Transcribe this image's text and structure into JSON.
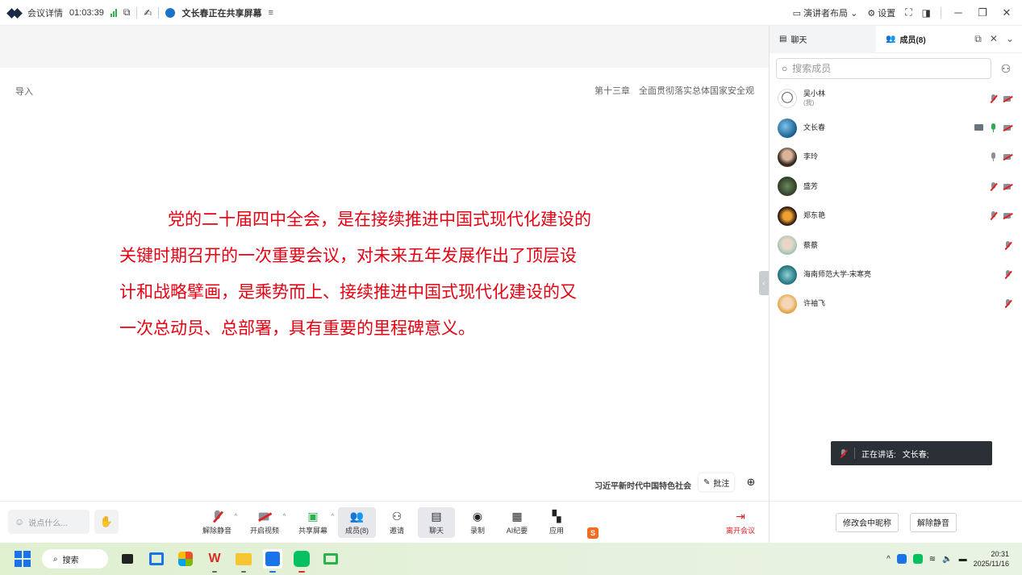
{
  "topbar": {
    "meeting_details": "会议详情",
    "timer": "01:03:39",
    "sharing_text": "文长春正在共享屏幕",
    "layout_label": "演讲者布局",
    "settings_label": "设置"
  },
  "slide": {
    "left_label": "导入",
    "chapter": "第十三章　全面贯彻落实总体国家安全观",
    "lines": [
      "党的二十届四中全会，是在接续推进中国式现代化建设的",
      "关键时期召开的一次重要会议，对未来五年发展作出了顶层设",
      "计和战略擘画，是乘势而上、接续推进中国式现代化建设的又",
      "一次总动员、总部署，具有重要的里程碑意义。"
    ],
    "footer": "习近平新时代中国特色社会",
    "annotate_label": "批注"
  },
  "panel": {
    "tab_chat": "聊天",
    "tab_members": "成员(8)",
    "search_placeholder": "搜索成员",
    "members": [
      {
        "name": "吴小林",
        "sub": "(我)"
      },
      {
        "name": "文长春",
        "sub": ""
      },
      {
        "name": "李玲",
        "sub": ""
      },
      {
        "name": "盛芳",
        "sub": ""
      },
      {
        "name": "郑东艳",
        "sub": ""
      },
      {
        "name": "蔡蔡",
        "sub": ""
      },
      {
        "name": "海南师范大学-宋寒亮",
        "sub": ""
      },
      {
        "name": "许袖飞",
        "sub": ""
      }
    ],
    "speaking_label": "正在讲话:",
    "speaking_name": "文长春;",
    "rename_btn": "修改会中昵称",
    "unmute_btn": "解除静音"
  },
  "toolbar": {
    "say_placeholder": "说点什么...",
    "unmute": "解除静音",
    "video": "开启视频",
    "share": "共享屏幕",
    "members": "成员(8)",
    "invite": "邀请",
    "chat": "聊天",
    "record": "录制",
    "ai_notes": "AI纪要",
    "apps": "应用",
    "leave": "离开会议"
  },
  "taskbar": {
    "search_label": "搜索",
    "time": "20:31",
    "date": "2025/11/16"
  },
  "colors": {
    "slide_text": "#e60012",
    "accent": "#1a73e8",
    "leave": "#e02020"
  }
}
